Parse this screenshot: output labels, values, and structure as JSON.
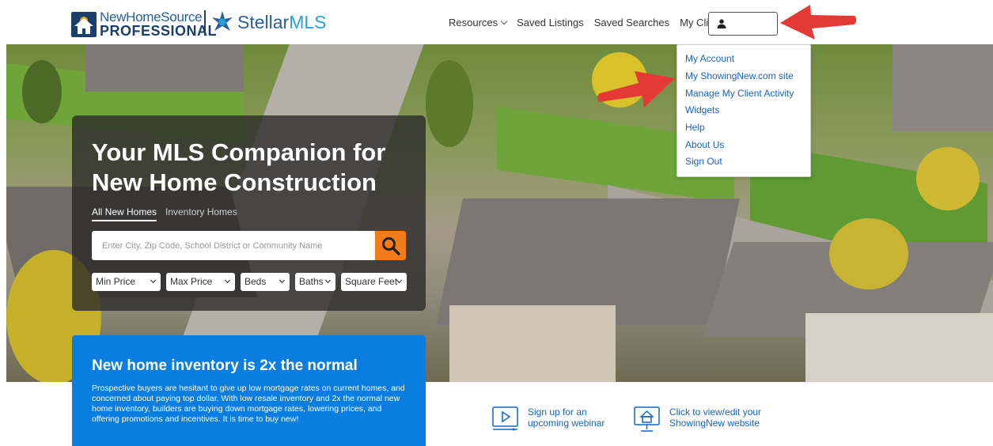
{
  "header": {
    "logo_nhs_line1": "NewHomeSource",
    "logo_nhs_line2": "PROFESSIONAL",
    "logo_stellar_a": "Stellar",
    "logo_stellar_b": "MLS",
    "nav": [
      {
        "label": "Resources"
      },
      {
        "label": "Saved Listings"
      },
      {
        "label": "Saved Searches"
      },
      {
        "label": "My Clients"
      }
    ]
  },
  "account_menu": {
    "items": [
      {
        "label": "My Account"
      },
      {
        "label": "My ShowingNew.com site"
      },
      {
        "label": "Manage My Client Activity"
      },
      {
        "label": "Widgets"
      },
      {
        "label": "Help"
      },
      {
        "label": "About Us"
      },
      {
        "label": "Sign Out"
      }
    ]
  },
  "hero": {
    "title": "Your MLS Companion for New Home Construction",
    "tabs": [
      {
        "label": "All New Homes",
        "active": true
      },
      {
        "label": "Inventory Homes",
        "active": false
      }
    ],
    "search": {
      "placeholder": "Enter City, Zip Code, School District or Community Name",
      "value": ""
    },
    "filters": [
      {
        "label": "Min Price"
      },
      {
        "label": "Max Price"
      },
      {
        "label": "Beds"
      },
      {
        "label": "Baths"
      },
      {
        "label": "Square Feet"
      }
    ]
  },
  "info_card": {
    "title": "New home inventory is 2x the normal",
    "body": "Prospective buyers are hesitant to give up low mortgage rates on current homes, and concerned about paying top dollar. With low resale inventory and 2x the normal new home inventory, builders are buying down mortgage rates, lowering prices, and offering promotions and incentives. It is time to buy new!"
  },
  "bottom_links": [
    {
      "line1": "Sign up for an",
      "line2": "upcoming webinar",
      "icon": "webinar-icon"
    },
    {
      "line1": "Click to view/edit your",
      "line2": "ShowingNew website",
      "icon": "website-icon"
    }
  ],
  "colors": {
    "accent_orange": "#f07d1a",
    "card_blue": "#0a7ee0",
    "link_blue": "#1a63c6",
    "annotation_red": "#e53935"
  }
}
